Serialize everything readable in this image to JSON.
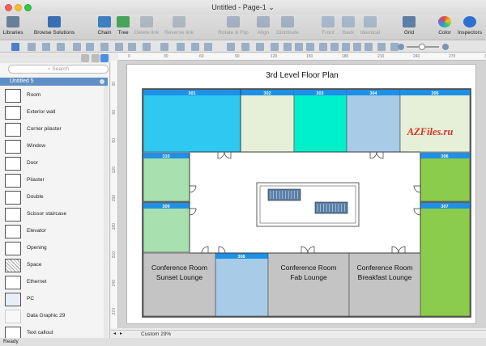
{
  "window": {
    "title": "Untitled - Page-1 ⌄"
  },
  "toolbar": {
    "buttons": [
      {
        "name": "libraries-button",
        "label": "Libraries",
        "icon": "libraries-icon",
        "disabled": false
      },
      {
        "name": "browse-solutions-button",
        "label": "Browse Solutions",
        "icon": "solutions-icon",
        "disabled": false
      },
      {
        "name": "chain-button",
        "label": "Chain",
        "icon": "chain-icon",
        "disabled": false
      },
      {
        "name": "tree-button",
        "label": "Tree",
        "icon": "tree-icon",
        "disabled": false
      },
      {
        "name": "delete-link-button",
        "label": "Delete link",
        "icon": "delete-link-icon",
        "disabled": true
      },
      {
        "name": "reverse-link-button",
        "label": "Reverse link",
        "icon": "reverse-link-icon",
        "disabled": true
      },
      {
        "name": "rotate-flip-button",
        "label": "Rotate & Flip",
        "icon": "rotate-icon",
        "disabled": true
      },
      {
        "name": "align-button",
        "label": "Align",
        "icon": "align-icon",
        "disabled": true
      },
      {
        "name": "distribute-button",
        "label": "Distribute",
        "icon": "distribute-icon",
        "disabled": true
      },
      {
        "name": "front-button",
        "label": "Front",
        "icon": "front-icon",
        "disabled": true
      },
      {
        "name": "back-button",
        "label": "Back",
        "icon": "back-icon",
        "disabled": true
      },
      {
        "name": "identical-button",
        "label": "Identical",
        "icon": "identical-icon",
        "disabled": true
      },
      {
        "name": "grid-button",
        "label": "Grid",
        "icon": "grid-icon",
        "disabled": false
      },
      {
        "name": "color-button",
        "label": "Color",
        "icon": "color-wheel-icon",
        "disabled": false
      },
      {
        "name": "inspectors-button",
        "label": "Inspectors",
        "icon": "info-icon",
        "disabled": false
      }
    ]
  },
  "sidebar": {
    "search_placeholder": "Search",
    "library_title": "Untitled 5",
    "shapes": [
      {
        "label": "Room",
        "icon": "room-icon"
      },
      {
        "label": "Exterior wall",
        "icon": "exterior-wall-icon"
      },
      {
        "label": "Corner pilaster",
        "icon": "corner-pilaster-icon"
      },
      {
        "label": "Window",
        "icon": "window-icon"
      },
      {
        "label": "Door",
        "icon": "door-icon"
      },
      {
        "label": "Pilaster",
        "icon": "pilaster-icon"
      },
      {
        "label": "Double",
        "icon": "double-door-icon"
      },
      {
        "label": "Scissor staircase",
        "icon": "staircase-icon"
      },
      {
        "label": "Elevator",
        "icon": "elevator-icon"
      },
      {
        "label": "Opening",
        "icon": "opening-icon"
      },
      {
        "label": "Space",
        "icon": "space-icon"
      },
      {
        "label": "Ethernet",
        "icon": "ethernet-icon"
      },
      {
        "label": "PC",
        "icon": "pc-icon"
      },
      {
        "label": "Data Graphic 29",
        "icon": "data-graphic-icon"
      },
      {
        "label": "Text callout",
        "icon": "text-callout-icon"
      }
    ]
  },
  "rulers": {
    "h": [
      "0",
      "30",
      "60",
      "90",
      "120",
      "150",
      "180",
      "210",
      "240",
      "270",
      "300"
    ],
    "v": [
      "30",
      "60",
      "90",
      "120",
      "150",
      "180",
      "210",
      "240",
      "270"
    ]
  },
  "floorplan": {
    "title": "3rd Level Floor Plan",
    "watermark": "AZFiles.ru",
    "colors": {
      "cyan": "#2ec8f0",
      "pale_green": "#e6f0d8",
      "teal": "#00f0cc",
      "light_blue": "#a8cbe8",
      "green": "#8ccc4c",
      "mint": "#a8e0b0",
      "grey": "#c4c4c4",
      "header": "#1e90e6",
      "wall": "#3a3a3a"
    },
    "rooms": [
      {
        "number": "301"
      },
      {
        "number": "302"
      },
      {
        "number": "303"
      },
      {
        "number": "304"
      },
      {
        "number": "305"
      },
      {
        "number": "310"
      },
      {
        "number": "306"
      },
      {
        "number": "309"
      },
      {
        "number": "307"
      },
      {
        "number": "308"
      }
    ],
    "conference_rooms": [
      {
        "line1": "Conference Room",
        "line2": "Sunset Lounge"
      },
      {
        "line1": "Conference Room",
        "line2": "Fab Lounge"
      },
      {
        "line1": "Conference Room",
        "line2": "Breakfast Lounge"
      }
    ]
  },
  "footer": {
    "zoom": "Custom 29%",
    "status": "Ready"
  }
}
